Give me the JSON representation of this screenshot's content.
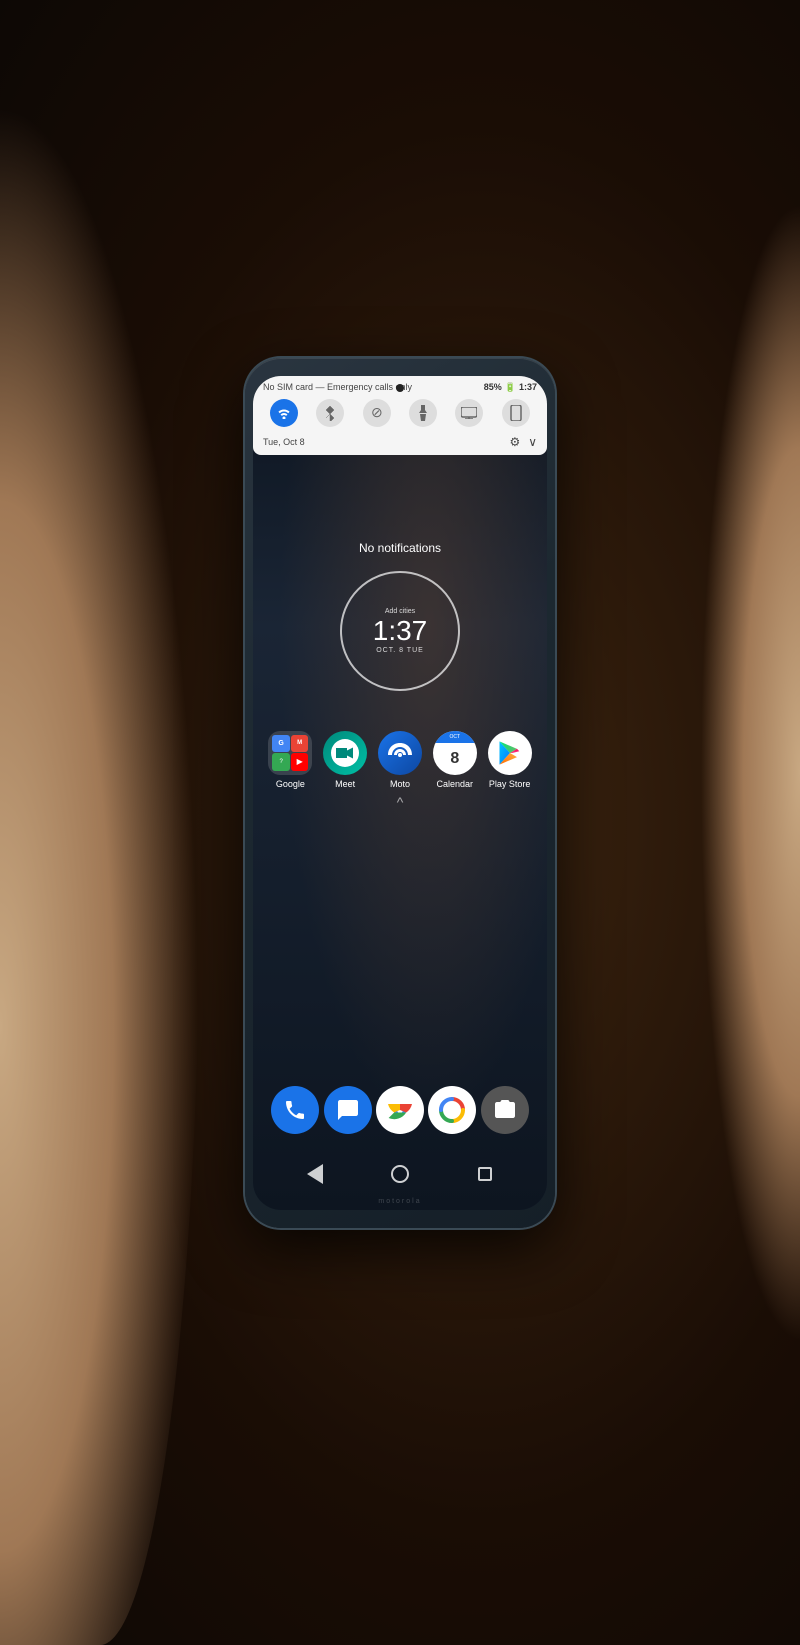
{
  "background": {
    "color": "#2a1a0e"
  },
  "phone": {
    "brand": "motorola",
    "status_bar": {
      "sim_text": "No SIM card — Emergency calls only",
      "battery": "85%",
      "time": "1:37"
    },
    "quick_toggles": [
      {
        "name": "wifi",
        "active": true,
        "symbol": "▼"
      },
      {
        "name": "bluetooth",
        "active": false,
        "symbol": "⚡"
      },
      {
        "name": "dnd",
        "active": false,
        "symbol": "⊘"
      },
      {
        "name": "flashlight",
        "active": false,
        "symbol": "⚡"
      },
      {
        "name": "screen_cast",
        "active": false,
        "symbol": "▭"
      },
      {
        "name": "screen_rotate",
        "active": false,
        "symbol": "▭"
      }
    ],
    "date": "Tue, Oct 8",
    "no_notifications_text": "No notifications",
    "clock_widget": {
      "add_cities": "Add cities",
      "time": "1:37",
      "date": "OCT. 8  TUE"
    },
    "apps": [
      {
        "name": "Google",
        "label": "Google",
        "type": "folder"
      },
      {
        "name": "Meet",
        "label": "Meet",
        "type": "meet"
      },
      {
        "name": "Moto",
        "label": "Moto",
        "type": "moto"
      },
      {
        "name": "Calendar",
        "label": "Calendar",
        "type": "calendar",
        "date_num": "8"
      },
      {
        "name": "PlayStore",
        "label": "Play Store",
        "type": "playstore"
      }
    ],
    "dock": [
      {
        "name": "Phone",
        "type": "phone"
      },
      {
        "name": "Messages",
        "type": "messages"
      },
      {
        "name": "Chrome",
        "type": "chrome"
      },
      {
        "name": "Photos",
        "type": "photos"
      },
      {
        "name": "Camera",
        "type": "camera"
      }
    ],
    "nav": {
      "back": "◁",
      "home": "○",
      "recents": "□"
    }
  }
}
